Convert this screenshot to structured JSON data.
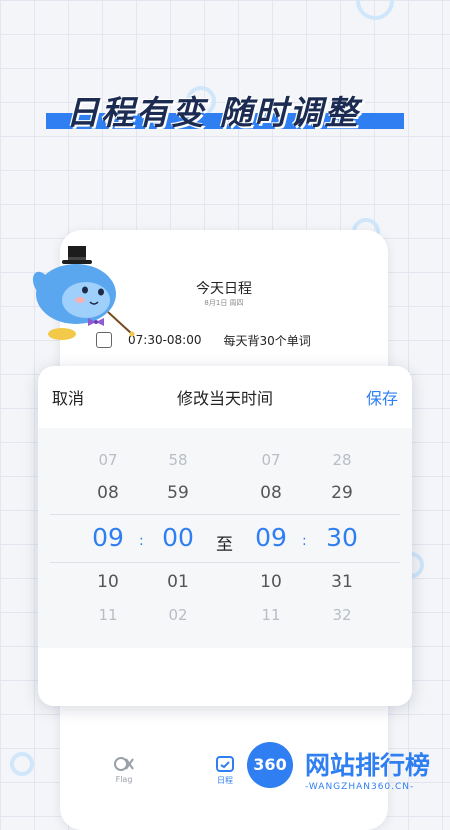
{
  "headline": "日程有变  随时调整",
  "schedule": {
    "title": "今天日程",
    "date": "8月1日 周四",
    "task": {
      "time": "07:30-08:00",
      "name": "每天背30个单词"
    }
  },
  "modal": {
    "cancel": "取消",
    "title": "修改当天时间",
    "save": "保存",
    "separator": "至",
    "colon": ":",
    "start_hour": {
      "far_above": "07",
      "above": "08",
      "selected": "09",
      "below": "10",
      "far_below": "11"
    },
    "start_minute": {
      "far_above": "58",
      "above": "59",
      "selected": "00",
      "below": "01",
      "far_below": "02"
    },
    "end_hour": {
      "far_above": "07",
      "above": "08",
      "selected": "09",
      "below": "10",
      "far_below": "11"
    },
    "end_minute": {
      "far_above": "28",
      "above": "29",
      "selected": "30",
      "below": "31",
      "far_below": "32"
    }
  },
  "tabbar": {
    "flag_label": "Flag",
    "schedule_label": "日程"
  },
  "watermark": {
    "badge": "360",
    "title": "网站排行榜",
    "url": "-WANGZHAN360.CN-"
  },
  "colors": {
    "accent": "#2f7ff2",
    "headline_text": "#1b2b52",
    "background": "#f4f5f8"
  },
  "icons": [
    "flag-icon",
    "calendar-icon",
    "mascot-illustration",
    "top-hat-icon",
    "bow-tie-icon"
  ]
}
